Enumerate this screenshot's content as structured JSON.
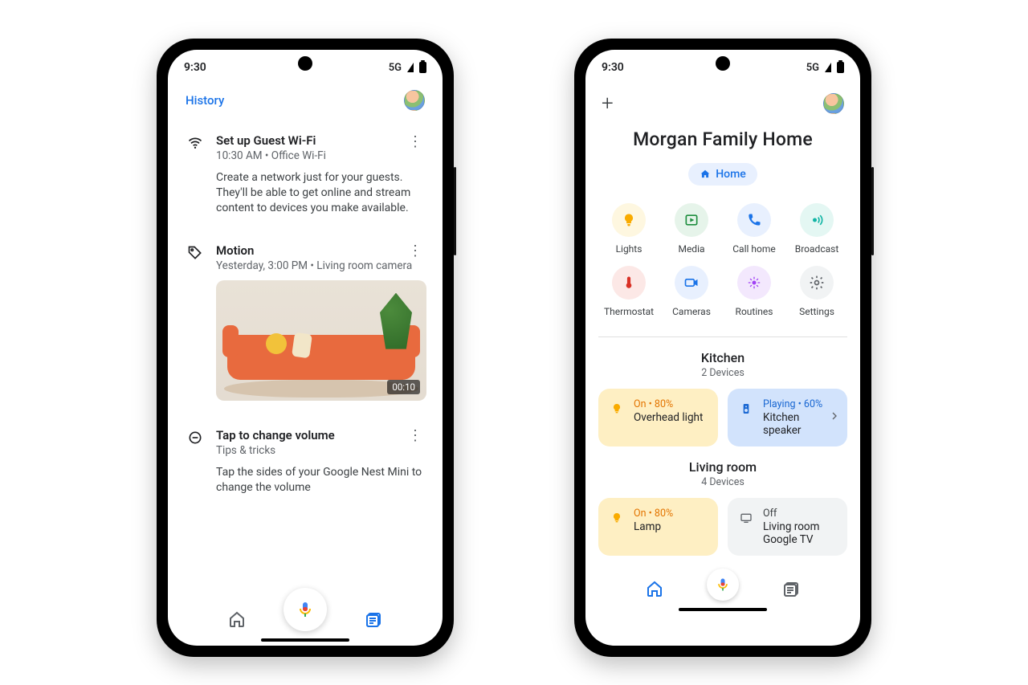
{
  "status_bar": {
    "time": "9:30",
    "network": "5G"
  },
  "left": {
    "history_label": "History",
    "items": [
      {
        "title": "Set up Guest Wi-Fi",
        "subtitle": "10:30 AM • Office Wi-Fi",
        "description": "Create a network just for your guests. They'll be able to get online and stream content to devices you make available."
      },
      {
        "title": "Motion",
        "subtitle": "Yesterday, 3:00 PM • Living room camera",
        "clip_duration": "00:10"
      },
      {
        "title": "Tap to change volume",
        "subtitle": "Tips & tricks",
        "description": "Tap the sides of your Google Nest Mini to change the volume"
      }
    ]
  },
  "right": {
    "title": "Morgan Family Home",
    "chip": "Home",
    "shortcuts": [
      {
        "label": "Lights",
        "icon": "light"
      },
      {
        "label": "Media",
        "icon": "media"
      },
      {
        "label": "Call home",
        "icon": "phone"
      },
      {
        "label": "Broadcast",
        "icon": "broadcast"
      },
      {
        "label": "Thermostat",
        "icon": "thermostat"
      },
      {
        "label": "Cameras",
        "icon": "camera"
      },
      {
        "label": "Routines",
        "icon": "routines"
      },
      {
        "label": "Settings",
        "icon": "settings"
      }
    ],
    "rooms": [
      {
        "name": "Kitchen",
        "sub": "2 Devices",
        "cards": [
          {
            "style": "amber",
            "status": "On • 80%",
            "name": "Overhead light"
          },
          {
            "style": "blue",
            "status": "Playing • 60%",
            "name": "Kitchen speaker",
            "chevron": true
          }
        ]
      },
      {
        "name": "Living room",
        "sub": "4 Devices",
        "cards": [
          {
            "style": "amber",
            "status": "On • 80%",
            "name": "Lamp"
          },
          {
            "style": "grey",
            "status": "Off",
            "name": "Living room Google TV"
          }
        ]
      }
    ]
  },
  "colors": {
    "google_blue": "#1a73e8",
    "google_red": "#ea4335",
    "google_yellow": "#fbbc04",
    "google_green": "#34a853"
  }
}
